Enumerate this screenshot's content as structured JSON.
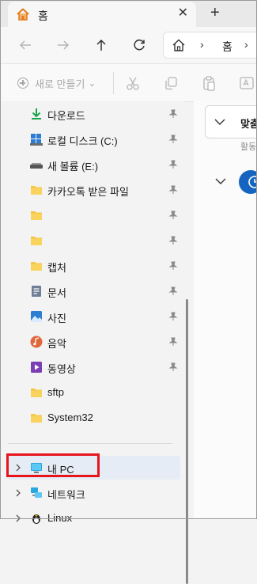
{
  "titlebar": {
    "tab_title": "홈",
    "close_glyph": "✕",
    "add_glyph": "+"
  },
  "address": {
    "home_sep": "›",
    "crumb": "홈",
    "crumb_sep": "›"
  },
  "commandbar": {
    "new_label": "새로 만들기",
    "new_caret": "⌄"
  },
  "sidebar": {
    "items": [
      {
        "label": "다운로드",
        "icon": "download-icon",
        "pinned": true
      },
      {
        "label": "로컬 디스크 (C:)",
        "icon": "drive-icon",
        "pinned": true
      },
      {
        "label": "새 볼륨 (E:)",
        "icon": "drive-icon",
        "pinned": true
      },
      {
        "label": "카카오톡 받은 파일",
        "icon": "folder-icon",
        "pinned": true
      },
      {
        "label": "",
        "icon": "folder-icon",
        "pinned": true
      },
      {
        "label": "",
        "icon": "folder-icon",
        "pinned": true
      },
      {
        "label": "캡처",
        "icon": "folder-icon",
        "pinned": true
      },
      {
        "label": "문서",
        "icon": "documents-icon",
        "pinned": true
      },
      {
        "label": "사진",
        "icon": "pictures-icon",
        "pinned": true
      },
      {
        "label": "음악",
        "icon": "music-icon",
        "pinned": true
      },
      {
        "label": "동영상",
        "icon": "videos-icon",
        "pinned": true
      },
      {
        "label": "sftp",
        "icon": "folder-icon",
        "pinned": false
      },
      {
        "label": "System32",
        "icon": "folder-icon",
        "pinned": false
      }
    ],
    "tree": [
      {
        "label": "내 PC",
        "icon": "pc-icon"
      },
      {
        "label": "네트워크",
        "icon": "network-icon"
      },
      {
        "label": "Linux",
        "icon": "linux-icon"
      }
    ]
  },
  "content": {
    "card_title": "맞춤",
    "card_subtitle": "활동"
  },
  "colors": {
    "accent": "#1565c0",
    "highlight": "#e8141b",
    "folder": "#f4c542"
  }
}
